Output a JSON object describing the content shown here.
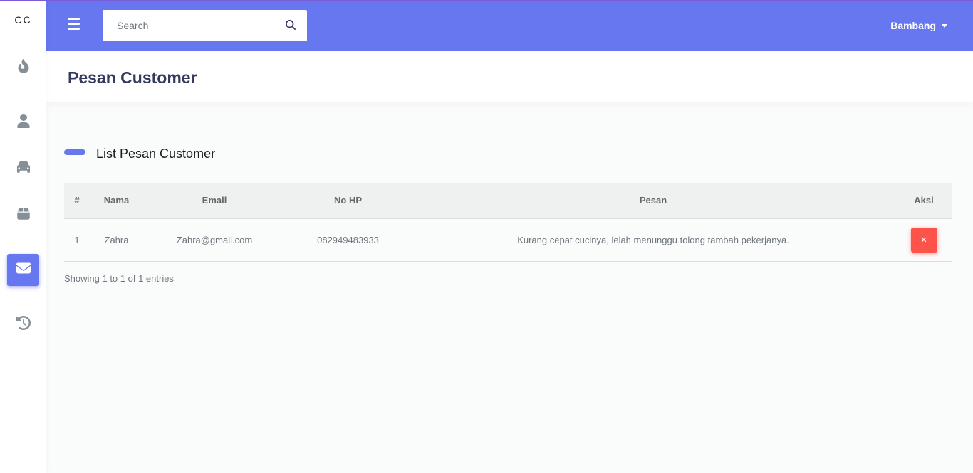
{
  "brand": "CC",
  "navbar": {
    "search_placeholder": "Search",
    "user_name": "Bambang"
  },
  "sidebar": {
    "items": [
      {
        "icon": "fire-icon",
        "active": false
      },
      {
        "icon": "user-icon",
        "active": false
      },
      {
        "icon": "car-icon",
        "active": false
      },
      {
        "icon": "box-icon",
        "active": false
      },
      {
        "icon": "envelope-icon",
        "active": true
      },
      {
        "icon": "history-icon",
        "active": false
      }
    ]
  },
  "page": {
    "title": "Pesan Customer",
    "section_title": "List Pesan Customer"
  },
  "table": {
    "headers": [
      "#",
      "Nama",
      "Email",
      "No HP",
      "Pesan",
      "Aksi"
    ],
    "rows": [
      {
        "no": "1",
        "nama": "Zahra",
        "email": "Zahra@gmail.com",
        "hp": "082949483933",
        "pesan": "Kurang cepat cucinya, lelah menunggu tolong tambah pekerjanya."
      }
    ],
    "info": "Showing 1 to 1 of 1 entries"
  },
  "colors": {
    "primary": "#6777ef",
    "danger": "#fc544b"
  }
}
